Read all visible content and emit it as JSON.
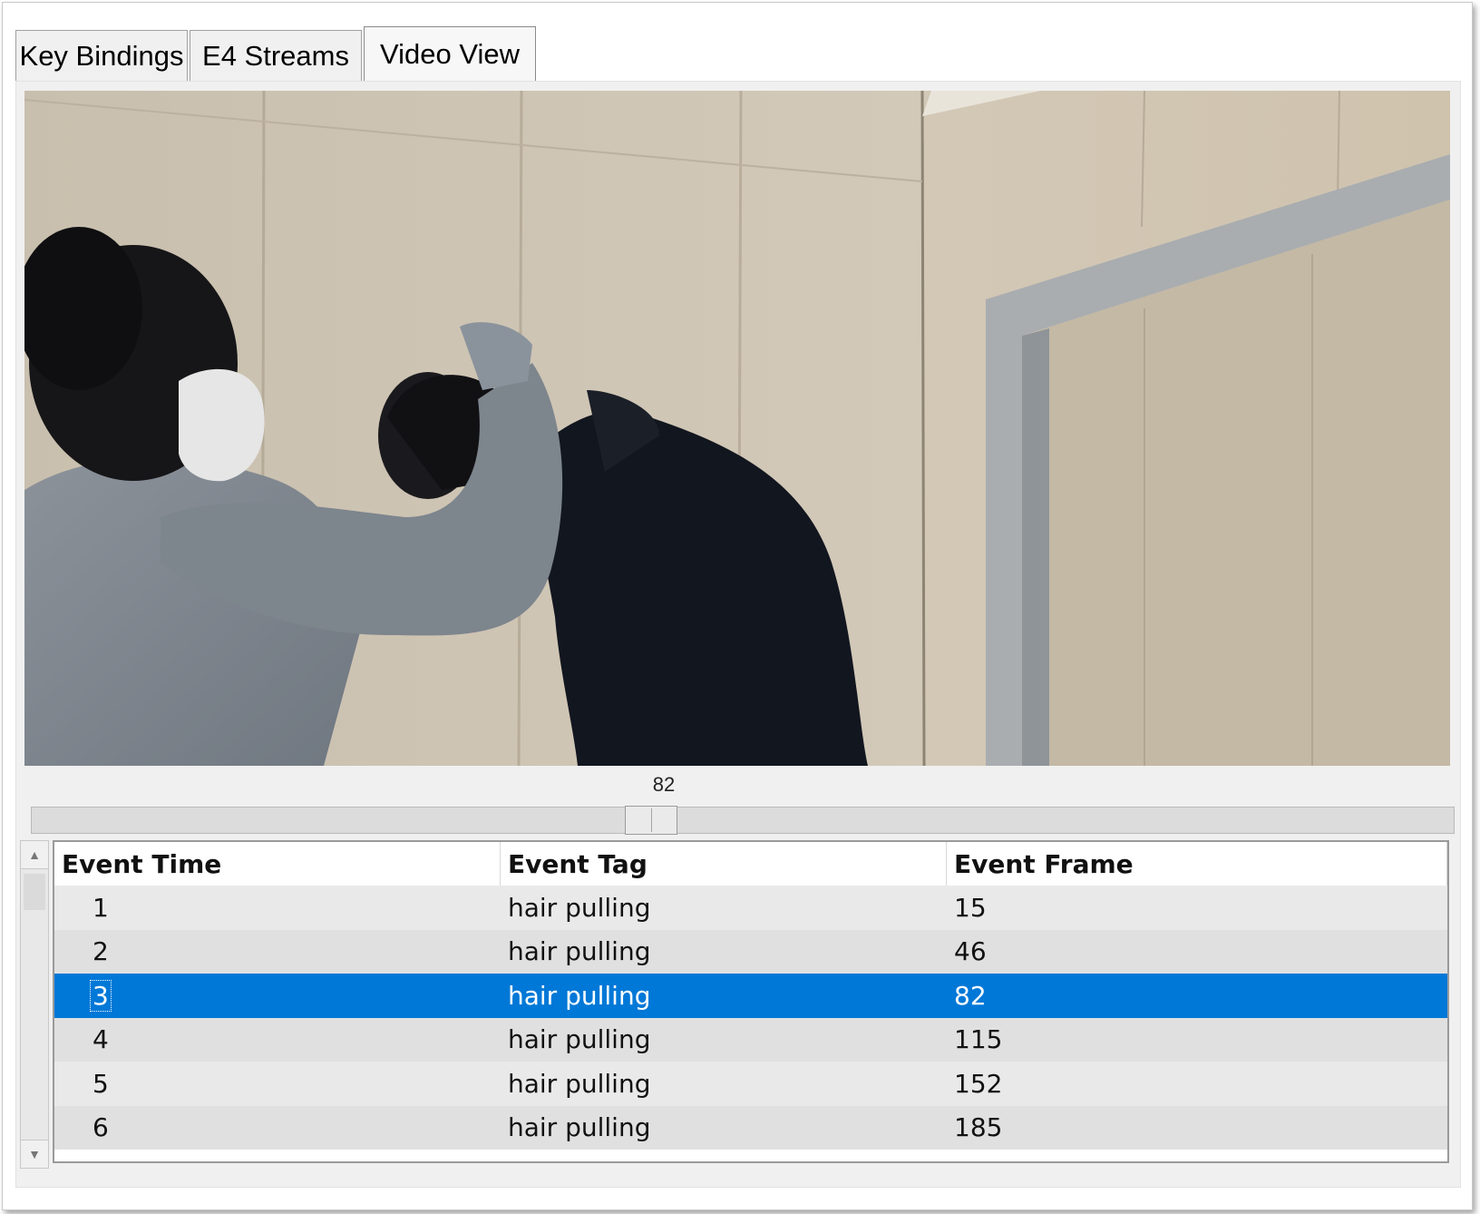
{
  "tabs": [
    {
      "label": "Key Bindings",
      "active": false
    },
    {
      "label": "E4 Streams",
      "active": false
    },
    {
      "label": "Video View",
      "active": true
    }
  ],
  "slider": {
    "value": "82",
    "position_fraction": 0.433
  },
  "table": {
    "columns": [
      "Event Time",
      "Event Tag",
      "Event Frame"
    ],
    "rows": [
      {
        "time": "1",
        "tag": "hair pulling",
        "frame": "15"
      },
      {
        "time": "2",
        "tag": "hair pulling",
        "frame": "46"
      },
      {
        "time": "3",
        "tag": "hair pulling",
        "frame": "82"
      },
      {
        "time": "4",
        "tag": "hair pulling",
        "frame": "115"
      },
      {
        "time": "5",
        "tag": "hair pulling",
        "frame": "152"
      },
      {
        "time": "6",
        "tag": "hair pulling",
        "frame": "185"
      }
    ],
    "selected_row_index": 2
  },
  "colors": {
    "selection": "#0078d7",
    "tab_background": "#f0f0f0",
    "panel_background": "#f0f0f0"
  },
  "icons": {
    "scroll_up": "scroll-up-arrow-icon",
    "scroll_down": "scroll-down-arrow-icon"
  }
}
